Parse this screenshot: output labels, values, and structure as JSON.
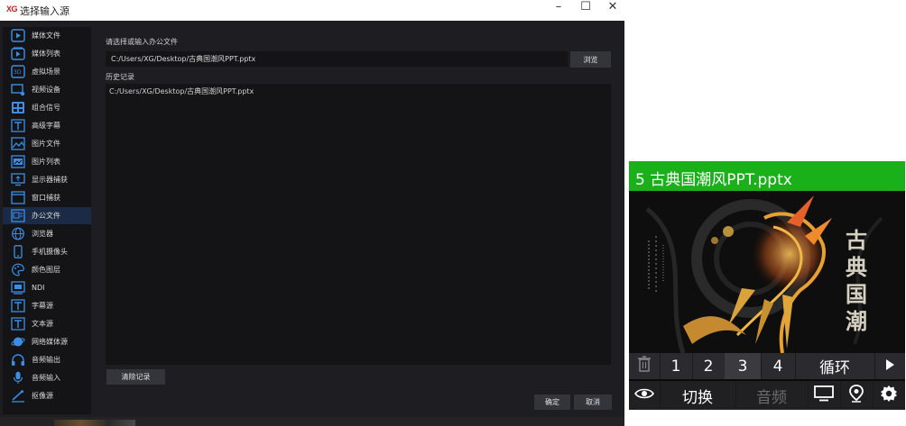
{
  "window": {
    "logo": "XG",
    "title": "选择输入源",
    "min_glyph": "–",
    "max_glyph": "☐",
    "close_glyph": "✕"
  },
  "sidebar": {
    "active_index": 10,
    "items": [
      {
        "label": "媒体文件",
        "icon": "play-icon"
      },
      {
        "label": "媒体列表",
        "icon": "playlist-icon"
      },
      {
        "label": "虚拟场景",
        "icon": "3d-scene-icon"
      },
      {
        "label": "视频设备",
        "icon": "video-device-icon"
      },
      {
        "label": "组合信号",
        "icon": "grid-icon"
      },
      {
        "label": "高级字幕",
        "icon": "text-icon"
      },
      {
        "label": "图片文件",
        "icon": "image-icon"
      },
      {
        "label": "图片列表",
        "icon": "image-list-icon"
      },
      {
        "label": "显示器捕获",
        "icon": "monitor-icon"
      },
      {
        "label": "窗口捕获",
        "icon": "window-icon"
      },
      {
        "label": "办公文件",
        "icon": "office-icon"
      },
      {
        "label": "浏览器",
        "icon": "globe-icon"
      },
      {
        "label": "手机摄像头",
        "icon": "phone-icon"
      },
      {
        "label": "颜色图层",
        "icon": "palette-icon"
      },
      {
        "label": "NDI",
        "icon": "ndi-icon"
      },
      {
        "label": "字幕源",
        "icon": "caption-icon"
      },
      {
        "label": "文本源",
        "icon": "text-source-icon"
      },
      {
        "label": "网络媒体源",
        "icon": "network-icon"
      },
      {
        "label": "音频输出",
        "icon": "headphone-icon"
      },
      {
        "label": "音频输入",
        "icon": "mic-icon"
      },
      {
        "label": "抠像源",
        "icon": "keying-icon"
      }
    ]
  },
  "main": {
    "path_label": "请选择或输入办公文件",
    "path_value": "C:/Users/XG/Desktop/古典国潮风PPT.pptx",
    "browse_label": "浏览",
    "history_label": "历史记录",
    "history": [
      "C:/Users/XG/Desktop/古典国潮风PPT.pptx"
    ],
    "clear_label": "清除记录",
    "ok_label": "确定",
    "cancel_label": "取消"
  },
  "preview": {
    "title": "5 古典国潮风PPT.pptx",
    "poster_text": [
      "古",
      "典",
      "国",
      "潮"
    ],
    "controls_row1": {
      "delete_icon": "trash-icon",
      "pages": [
        "1",
        "2",
        "3",
        "4"
      ],
      "selected_page": "3",
      "loop_label": "循环",
      "play_icon": "play-icon"
    },
    "controls_row2": {
      "eye_icon": "eye-icon",
      "switch_label": "切换",
      "audio_label": "音频",
      "monitor_icon": "monitor-icon",
      "location_icon": "location-icon",
      "settings_icon": "gear-icon"
    },
    "colors": {
      "header": "#1ab01a",
      "icon_blue": "#3a8ee6"
    }
  }
}
